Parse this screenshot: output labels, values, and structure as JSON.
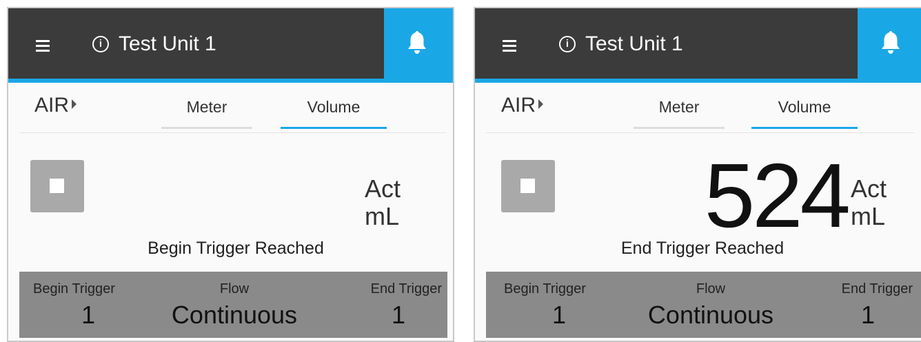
{
  "screens": [
    {
      "title": "Test Unit 1",
      "info_icon": "info-circle-icon",
      "menu_icon": "hamburger-menu-icon",
      "bell_icon": "bell-icon",
      "gas": "AIR",
      "tabs": [
        {
          "label": "Meter",
          "active": false
        },
        {
          "label": "Volume",
          "active": true
        }
      ],
      "value": "",
      "unit_line1": "Act",
      "unit_line2": "mL",
      "status": "Begin Trigger Reached",
      "footer": {
        "begin_trigger_label": "Begin Trigger",
        "begin_trigger_value": "1",
        "flow_label": "Flow",
        "flow_value": "Continuous",
        "end_trigger_label": "End Trigger",
        "end_trigger_value": "1"
      }
    },
    {
      "title": "Test Unit 1",
      "info_icon": "info-circle-icon",
      "menu_icon": "hamburger-menu-icon",
      "bell_icon": "bell-icon",
      "gas": "AIR",
      "tabs": [
        {
          "label": "Meter",
          "active": false
        },
        {
          "label": "Volume",
          "active": true
        }
      ],
      "value": "524",
      "unit_line1": "Act",
      "unit_line2": "mL",
      "status": "End Trigger Reached",
      "footer": {
        "begin_trigger_label": "Begin Trigger",
        "begin_trigger_value": "1",
        "flow_label": "Flow",
        "flow_value": "Continuous",
        "end_trigger_label": "End Trigger",
        "end_trigger_value": "1"
      }
    }
  ],
  "colors": {
    "header_bg": "#3b3b3b",
    "accent": "#1aa7e6",
    "footer_bg": "#8a8a8a",
    "stop_button": "#a9a9a9"
  }
}
